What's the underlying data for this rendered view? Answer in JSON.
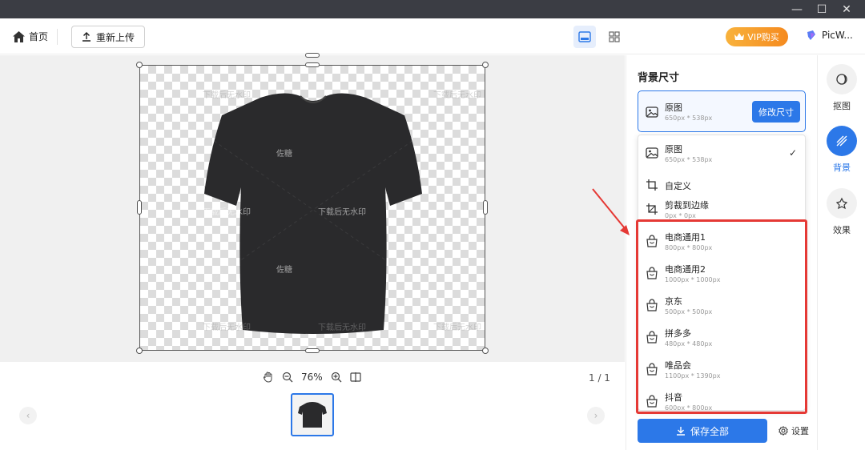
{
  "window": {
    "minimize": "—",
    "maximize": "☐",
    "close": "✕"
  },
  "toolbar": {
    "home_label": "首页",
    "reupload_label": "重新上传",
    "vip_label": "VIP购买",
    "brand_label": "PicW..."
  },
  "canvas": {
    "watermarks": [
      "下载后无水印",
      "佐糖"
    ]
  },
  "bottom": {
    "zoom": "76%",
    "pager": "1 / 1"
  },
  "panel": {
    "title": "背景尺寸",
    "current": {
      "name": "原图",
      "size": "650px * 538px",
      "modify_label": "修改尺寸"
    },
    "options": [
      {
        "name": "原图",
        "size": "650px * 538px",
        "icon": "image-icon",
        "selected": true
      },
      {
        "name": "自定义",
        "size": "",
        "icon": "crop-icon",
        "selected": false
      },
      {
        "name": "剪裁到边缘",
        "size": "0px * 0px",
        "icon": "crop-edge-icon",
        "selected": false
      },
      {
        "name": "电商通用1",
        "size": "800px * 800px",
        "icon": "shop-bag-icon",
        "selected": false
      },
      {
        "name": "电商通用2",
        "size": "1000px * 1000px",
        "icon": "shop-bag-icon",
        "selected": false
      },
      {
        "name": "京东",
        "size": "500px * 500px",
        "icon": "shop-bag-icon",
        "selected": false
      },
      {
        "name": "拼多多",
        "size": "480px * 480px",
        "icon": "shop-bag-icon",
        "selected": false
      },
      {
        "name": "唯品会",
        "size": "1100px * 1390px",
        "icon": "shop-bag-icon",
        "selected": false
      },
      {
        "name": "抖音",
        "size": "600px * 800px",
        "icon": "shop-bag-icon",
        "selected": false
      }
    ],
    "check": "✓",
    "save_all_label": "保存全部",
    "settings_label": "设置"
  },
  "rail": {
    "items": [
      {
        "label": "抠图",
        "active": false
      },
      {
        "label": "背景",
        "active": true
      },
      {
        "label": "效果",
        "active": false
      }
    ]
  },
  "colors": {
    "accent": "#2c78e8",
    "highlight": "#e53935",
    "vip": "#f58a1f"
  }
}
